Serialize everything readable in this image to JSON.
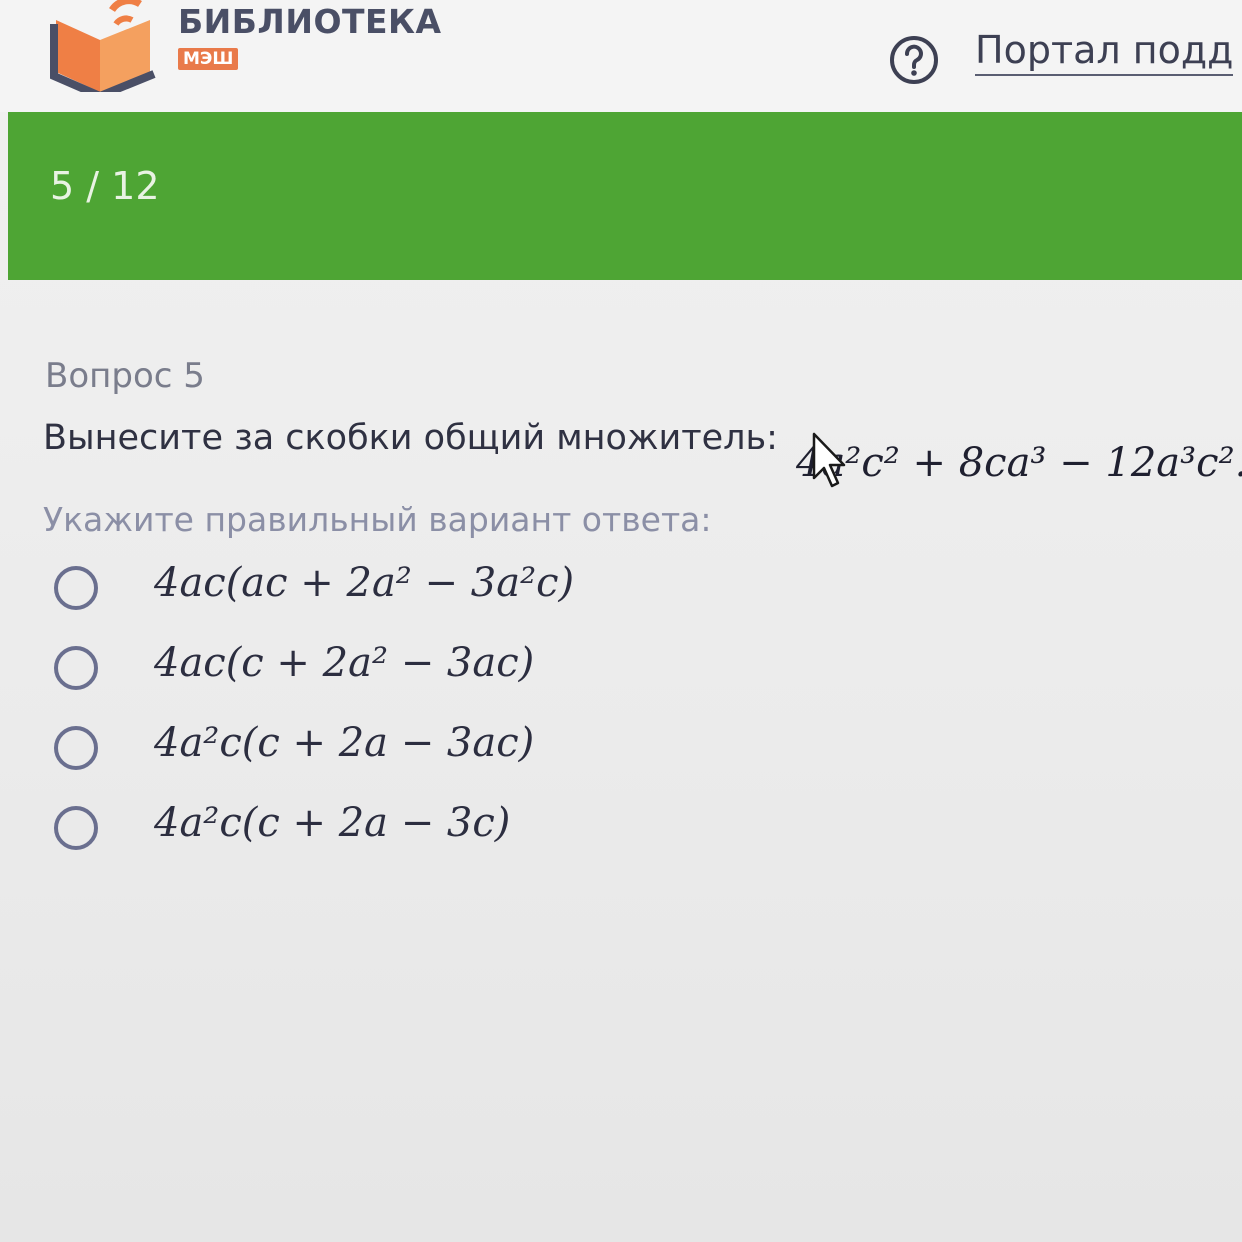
{
  "header": {
    "brand_title": "БИБЛИОТЕКА",
    "brand_badge": "МЭШ",
    "help_icon": "question-circle-icon",
    "support_link": "Портал подд"
  },
  "progress": {
    "text": "5 / 12",
    "color": "#4ea534"
  },
  "question": {
    "number_label": "Вопрос 5",
    "text": "Вынесите за скобки общий множитель:",
    "formula": "4a²c² + 8ca³ − 12a³c².",
    "instruction": "Укажите правильный вариант ответа:"
  },
  "options": [
    {
      "label": "4ac(ac + 2a² − 3a²c)",
      "selected": false
    },
    {
      "label": "4ac(c + 2a² − 3ac)",
      "selected": false
    },
    {
      "label": "4a²c(c + 2a − 3ac)",
      "selected": false
    },
    {
      "label": "4a²c(c + 2a − 3c)",
      "selected": false
    }
  ],
  "colors": {
    "accent_green": "#4ea534",
    "brand_orange": "#e97a4a",
    "radio_border": "#6a6f8f"
  }
}
